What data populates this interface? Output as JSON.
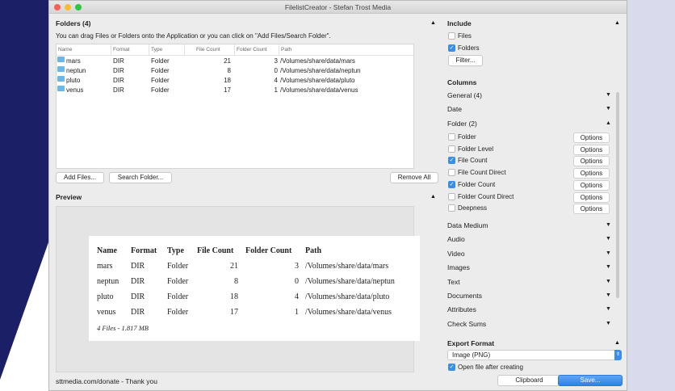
{
  "window": {
    "title": "FilelistCreator - Stefan Trost Media"
  },
  "folders": {
    "title": "Folders (4)",
    "hint": "You can drag Files or Folders onto the Application or you can click on \"Add Files/Search Folder\".",
    "columns": [
      "Name",
      "Format",
      "Type",
      "File Count",
      "Folder Count",
      "Path"
    ],
    "rows": [
      {
        "name": "mars",
        "format": "DIR",
        "type": "Folder",
        "file_count": "21",
        "folder_count": "3",
        "path": "/Volumes/share/data/mars"
      },
      {
        "name": "neptun",
        "format": "DIR",
        "type": "Folder",
        "file_count": "8",
        "folder_count": "0",
        "path": "/Volumes/share/data/neptun"
      },
      {
        "name": "pluto",
        "format": "DIR",
        "type": "Folder",
        "file_count": "18",
        "folder_count": "4",
        "path": "/Volumes/share/data/pluto"
      },
      {
        "name": "venus",
        "format": "DIR",
        "type": "Folder",
        "file_count": "17",
        "folder_count": "1",
        "path": "/Volumes/share/data/venus"
      }
    ],
    "add_files": "Add Files...",
    "search_folder": "Search Folder...",
    "remove_all": "Remove All"
  },
  "preview": {
    "title": "Preview",
    "summary": "4 Files - 1.817 MB"
  },
  "include": {
    "title": "Include",
    "files": "Files",
    "folders": "Folders",
    "files_checked": false,
    "folders_checked": true,
    "filter": "Filter..."
  },
  "columns": {
    "title": "Columns",
    "general": "General (4)",
    "date": "Date",
    "folder": "Folder (2)",
    "folder_items": [
      {
        "label": "Folder",
        "checked": false
      },
      {
        "label": "Folder Level",
        "checked": false
      },
      {
        "label": "File Count",
        "checked": true
      },
      {
        "label": "File Count Direct",
        "checked": false
      },
      {
        "label": "Folder Count",
        "checked": true
      },
      {
        "label": "Folder Count Direct",
        "checked": false
      },
      {
        "label": "Deepness",
        "checked": false
      }
    ],
    "options": "Options",
    "groups": [
      "Data Medium",
      "Audio",
      "Video",
      "Images",
      "Text",
      "Documents",
      "Attributes",
      "Check Sums"
    ]
  },
  "export": {
    "title": "Export Format",
    "format": "Image (PNG)",
    "open_after": "Open file after creating",
    "open_checked": true,
    "clipboard": "Clipboard",
    "save": "Save..."
  },
  "footer": {
    "donate": "sttmedia.com/donate - Thank you"
  }
}
